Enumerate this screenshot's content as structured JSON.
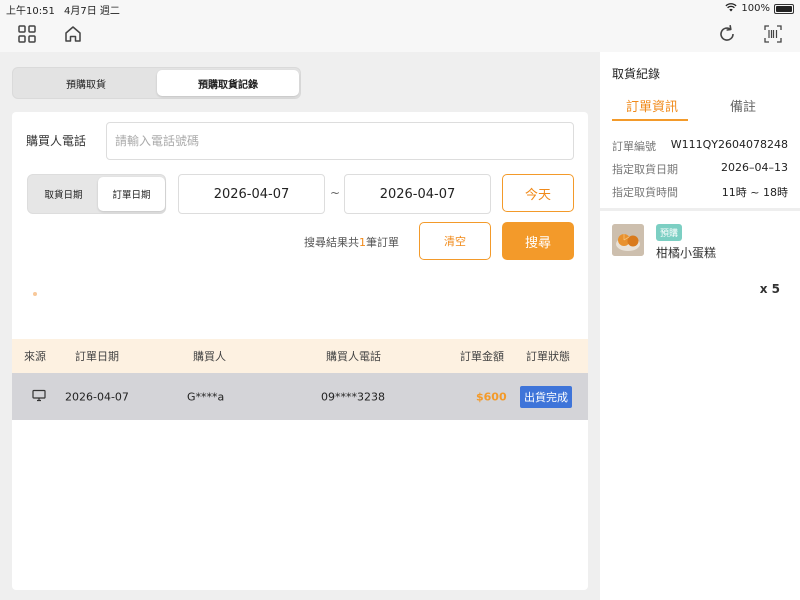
{
  "status_bar": {
    "time": "上午10:51",
    "date": "4月7日 週二",
    "battery": "100%"
  },
  "segment": {
    "options": [
      "預購取貨",
      "預購取貨記錄"
    ],
    "selected": 1
  },
  "search": {
    "phone_label": "購買人電話",
    "phone_placeholder": "請輸入電話號碼",
    "date_type_options": [
      "取貨日期",
      "訂單日期"
    ],
    "date_type_selected": 1,
    "date_from": "2026-04-07",
    "date_sep": "~",
    "date_to": "2026-04-07",
    "today_label": "今天",
    "result_prefix": "搜尋結果共",
    "result_count": "1",
    "result_suffix": "筆訂單",
    "clear_label": "清空",
    "search_label": "搜尋"
  },
  "table": {
    "headers": [
      "來源",
      "訂單日期",
      "購買人",
      "購買人電話",
      "訂單金額",
      "訂單狀態"
    ],
    "rows": [
      {
        "source_icon": "monitor-icon",
        "date": "2026-04-07",
        "buyer": "G****a",
        "phone": "09****3238",
        "amount": "$600",
        "status": "出貨完成"
      }
    ]
  },
  "side": {
    "title": "取貨紀錄",
    "tabs": [
      "訂單資訊",
      "備註"
    ],
    "info": [
      {
        "label": "訂單編號",
        "value": "W111QY2604078248"
      },
      {
        "label": "指定取貨日期",
        "value": "2026–04–13"
      },
      {
        "label": "指定取貨時間",
        "value": "11時 ~ 18時"
      }
    ],
    "item": {
      "badge": "預購",
      "name": "柑橘小蛋糕",
      "qty": "x 5"
    }
  },
  "colors": {
    "accent": "#f39a2a",
    "status_done": "#3e74d9",
    "badge_pre": "#7ccfc3",
    "header_bg": "#fdf1e1"
  }
}
